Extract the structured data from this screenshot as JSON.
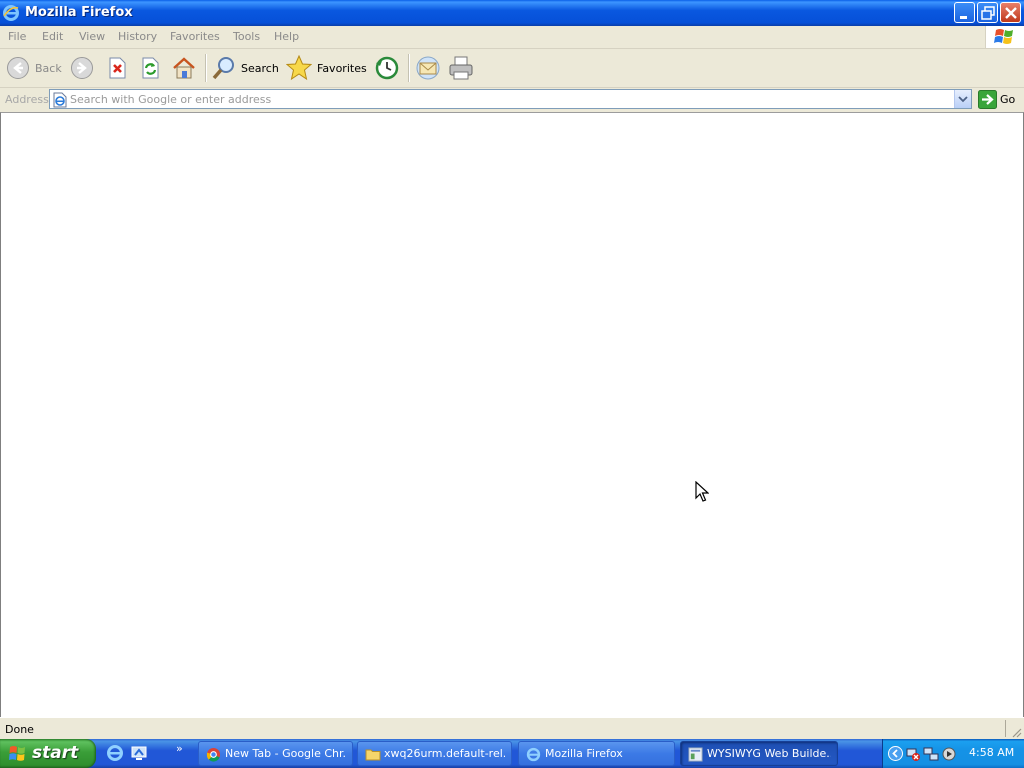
{
  "window": {
    "title": "Mozilla Firefox"
  },
  "menu": {
    "items": [
      "File",
      "Edit",
      "View",
      "History",
      "Favorites",
      "Tools",
      "Help"
    ]
  },
  "toolbar": {
    "back_label": "Back",
    "search_label": "Search",
    "favorites_label": "Favorites"
  },
  "address": {
    "label": "Address",
    "placeholder": "Search with Google or enter address",
    "value": "",
    "go_label": "Go"
  },
  "status": {
    "text": "Done"
  },
  "taskbar": {
    "start_label": "start",
    "tasks": [
      {
        "label": "New Tab - Google Chr...",
        "icon": "chrome-icon",
        "active": false
      },
      {
        "label": "xwq26urm.default-rel...",
        "icon": "folder-icon",
        "active": false
      },
      {
        "label": "Mozilla Firefox",
        "icon": "ie-icon",
        "active": false
      },
      {
        "label": "WYSIWYG Web Builde...",
        "icon": "wysiwyg-icon",
        "active": true
      }
    ],
    "clock": "4:58 AM"
  },
  "colors": {
    "titlebar": "#0a58e0",
    "taskbar": "#2157d7",
    "start_green": "#3a9e38",
    "tray": "#1592e6"
  }
}
